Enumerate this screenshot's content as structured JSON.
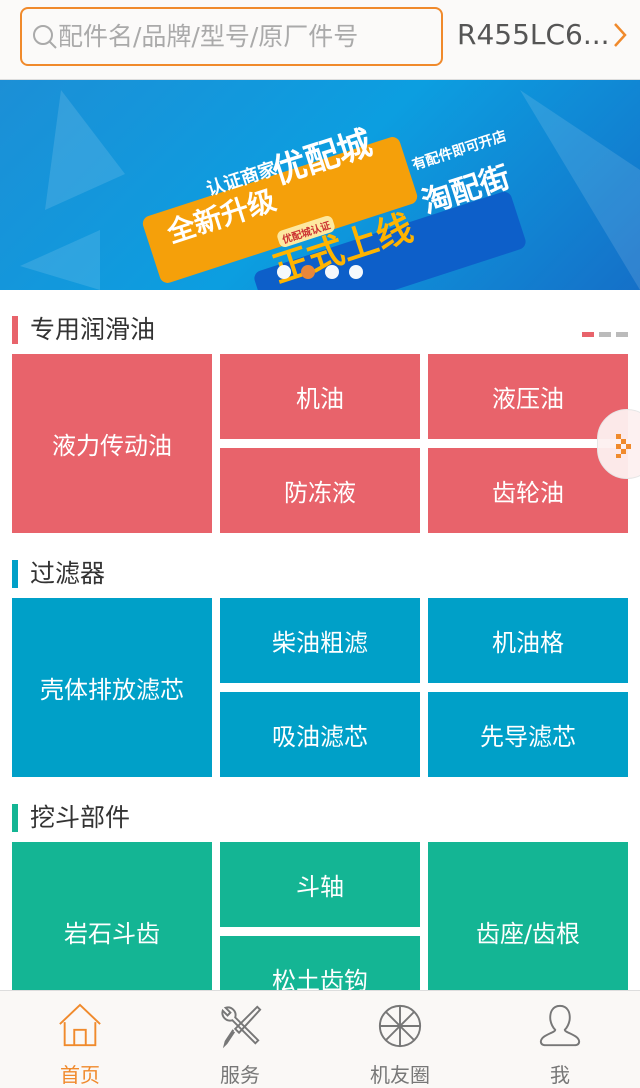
{
  "header": {
    "search_placeholder": "配件名/品牌/型号/原厂件号",
    "model": "R455LC6..."
  },
  "banner": {
    "line1": "认证商家",
    "line2": "全新升级",
    "line3": "优配城",
    "line4": "正式上线",
    "line5": "有配件即可开店",
    "line6": "淘配街",
    "badge": "优配城认证",
    "slide_count": 4,
    "active_slide": 2
  },
  "sections": [
    {
      "title": "专用润滑油",
      "color": "#e8636b",
      "tiles": [
        "液力传动油",
        "机油",
        "液压油",
        "防冻液",
        "齿轮油"
      ]
    },
    {
      "title": "过滤器",
      "color": "#00a0c8",
      "tiles": [
        "壳体排放滤芯",
        "柴油粗滤",
        "机油格",
        "吸油滤芯",
        "先导滤芯"
      ]
    },
    {
      "title": "挖斗部件",
      "color": "#14b594",
      "tiles": [
        "岩石斗齿",
        "斗轴",
        "齿座/齿根",
        "松土齿钩"
      ]
    }
  ],
  "nav": [
    {
      "label": "首页",
      "icon": "home-icon",
      "active": true
    },
    {
      "label": "服务",
      "icon": "tools-icon"
    },
    {
      "label": "机友圈",
      "icon": "aperture-icon"
    },
    {
      "label": "我",
      "icon": "user-icon"
    }
  ],
  "colors": {
    "accent": "#f08a2c"
  }
}
